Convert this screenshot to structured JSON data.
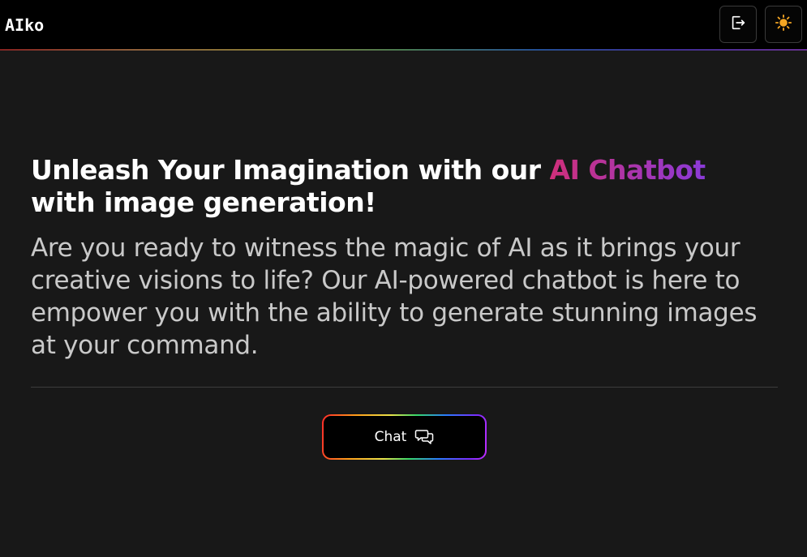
{
  "header": {
    "brand": "AIko",
    "logout_icon": "logout-icon",
    "theme_icon": "sun-icon"
  },
  "hero": {
    "title_before": "Unleash Your Imagination with our ",
    "title_accent": "AI Chatbot",
    "title_after": " with image generation!",
    "subtitle": "Are you ready to witness the magic of AI as it brings your creative visions to life? Our AI-powered chatbot is here to empower you with the ability to generate stunning images at your command."
  },
  "cta": {
    "label": "Chat",
    "icon": "chat-bubbles-icon"
  },
  "colors": {
    "background": "#181818",
    "topbar": "#000000",
    "accent_start": "#cf2f7a",
    "accent_end": "#8a3ad8",
    "sun": "#f5a623"
  }
}
